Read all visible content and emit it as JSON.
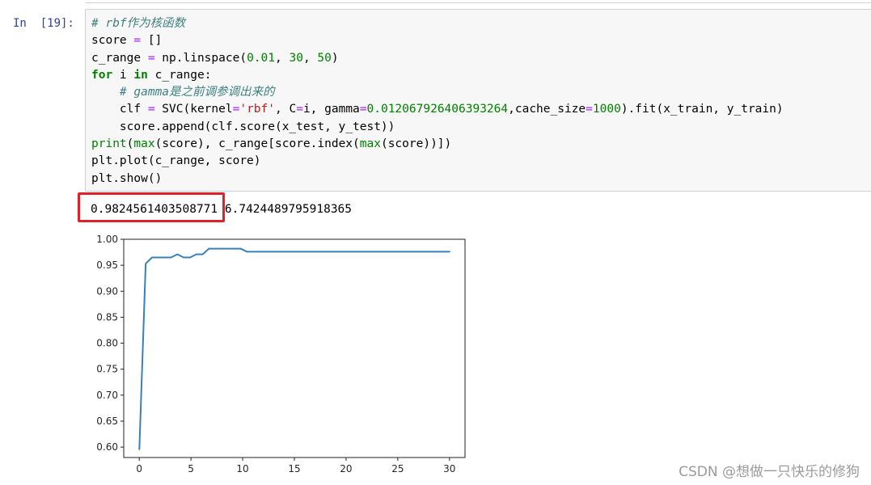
{
  "cell": {
    "prompt": "In  [19]:",
    "code": {
      "line1_comment": "# rbf作为核函数",
      "line2_a": "score ",
      "line2_op": "=",
      "line2_b": " []",
      "line3_a": "c_range ",
      "line3_op": "=",
      "line3_b": " np.linspace(",
      "line3_n1": "0.01",
      "line3_c": ", ",
      "line3_n2": "30",
      "line3_d": ", ",
      "line3_n3": "50",
      "line3_e": ")",
      "line4_kw1": "for",
      "line4_a": " i ",
      "line4_kw2": "in",
      "line4_b": " c_range:",
      "line5_indent": "    ",
      "line5_comment": "# gamma是之前调参调出来的",
      "line6_a": "    clf ",
      "line6_op1": "=",
      "line6_b": " SVC(kernel",
      "line6_op2": "=",
      "line6_str": "'rbf'",
      "line6_c": ", C",
      "line6_op3": "=",
      "line6_d": "i, gamma",
      "line6_op4": "=",
      "line6_n1": "0.012067926406393264",
      "line6_e": ",cache_size",
      "line6_op5": "=",
      "line6_n2": "1000",
      "line6_f": ").fit(x_train, y_train)",
      "line7": "    score.append(clf.score(x_test, y_test))",
      "line8_b1": "print",
      "line8_a": "(",
      "line8_b2": "max",
      "line8_b": "(score), c_range[score.index(",
      "line8_b3": "max",
      "line8_c": "(score))])",
      "line9": "plt.plot(c_range, score)",
      "line10": "plt.show()"
    }
  },
  "output": {
    "max_score": "0.9824561403508771",
    "best_c": "6.7424489795918365"
  },
  "watermark": "CSDN @想做一只快乐的修狗",
  "colors": {
    "line": "#3a80b8",
    "highlight": "#e0212c",
    "prompt": "#303f9f"
  },
  "chart_data": {
    "type": "line",
    "title": "",
    "xlabel": "",
    "ylabel": "",
    "xlim": [
      -1.5,
      31.5
    ],
    "ylim": [
      0.58,
      1.0
    ],
    "xticks": [
      0,
      5,
      10,
      15,
      20,
      25,
      30
    ],
    "yticks": [
      0.6,
      0.65,
      0.7,
      0.75,
      0.8,
      0.85,
      0.9,
      0.95,
      1.0
    ],
    "xtick_labels": [
      "0",
      "5",
      "10",
      "15",
      "20",
      "25",
      "30"
    ],
    "ytick_labels": [
      "0.60",
      "0.65",
      "0.70",
      "0.75",
      "0.80",
      "0.85",
      "0.90",
      "0.95",
      "1.00"
    ],
    "grid": false,
    "x": [
      0.01,
      0.622,
      1.234,
      1.846,
      2.458,
      3.07,
      3.682,
      4.294,
      4.906,
      5.518,
      6.13,
      6.742,
      7.354,
      7.967,
      8.579,
      9.191,
      9.803,
      10.415,
      11.027,
      11.639,
      12.251,
      12.863,
      13.475,
      14.087,
      14.699,
      15.311,
      15.923,
      16.535,
      17.147,
      17.759,
      18.371,
      18.983,
      19.595,
      20.207,
      20.819,
      21.431,
      22.043,
      22.655,
      23.267,
      23.879,
      24.491,
      25.103,
      25.715,
      26.327,
      26.939,
      27.551,
      28.163,
      28.776,
      29.388,
      30.0
    ],
    "series": [
      {
        "values": [
          0.596,
          0.953,
          0.965,
          0.965,
          0.965,
          0.965,
          0.971,
          0.965,
          0.965,
          0.971,
          0.971,
          0.982,
          0.982,
          0.982,
          0.982,
          0.982,
          0.982,
          0.976,
          0.976,
          0.976,
          0.976,
          0.976,
          0.976,
          0.976,
          0.976,
          0.976,
          0.976,
          0.976,
          0.976,
          0.976,
          0.976,
          0.976,
          0.976,
          0.976,
          0.976,
          0.976,
          0.976,
          0.976,
          0.976,
          0.976,
          0.976,
          0.976,
          0.976,
          0.976,
          0.976,
          0.976,
          0.976,
          0.976,
          0.976,
          0.976
        ]
      }
    ]
  }
}
